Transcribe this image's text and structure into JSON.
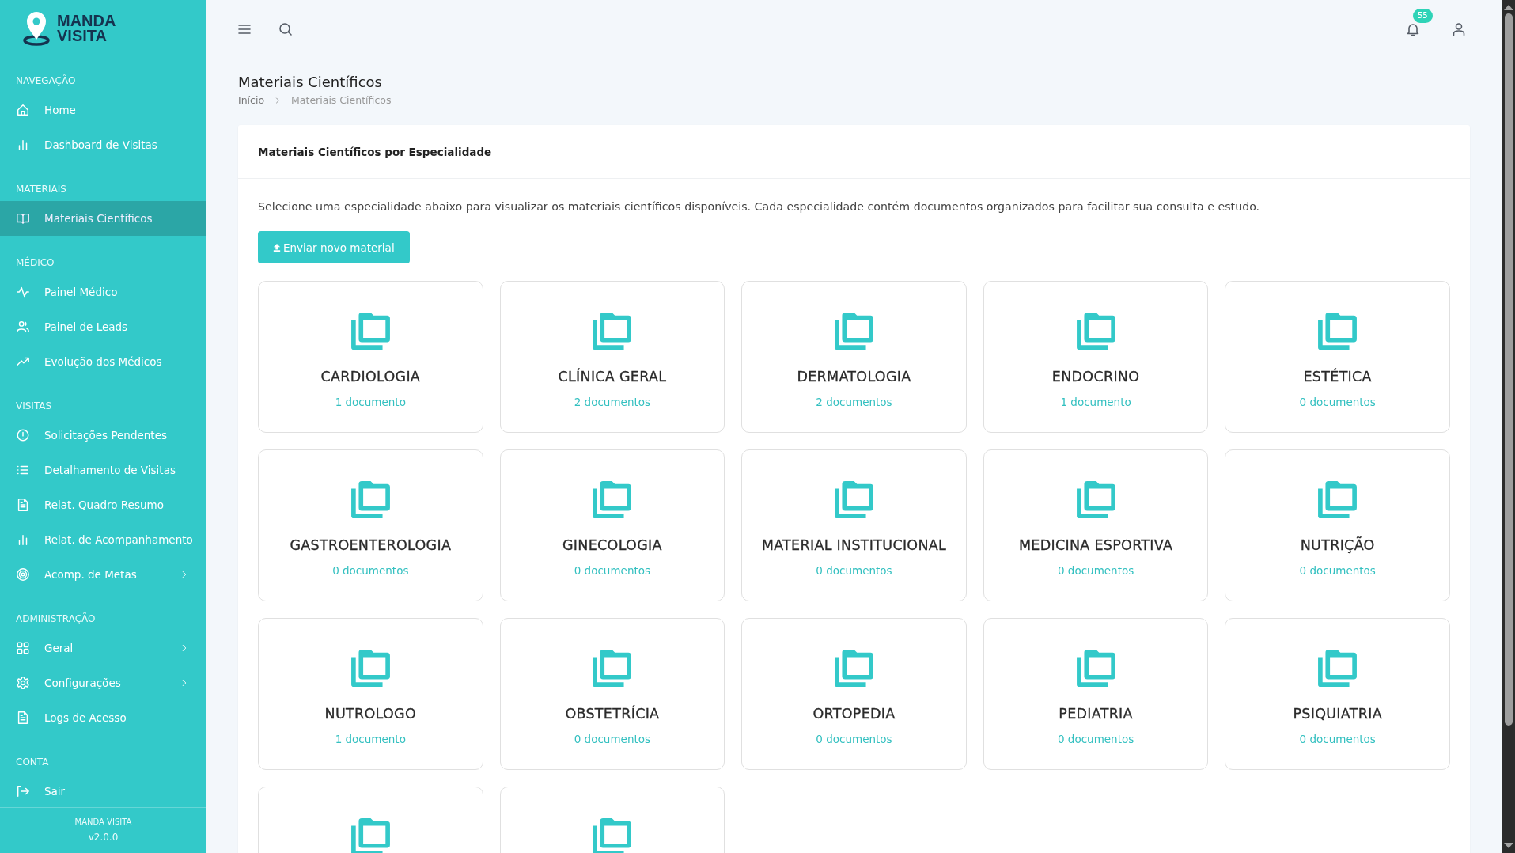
{
  "sidebar": {
    "logo": {
      "line1": "MANDA",
      "line2": "VISITA"
    },
    "sections": [
      {
        "title": "NAVEGAÇÃO",
        "items": [
          {
            "label": "Home",
            "selected": false,
            "expandable": false
          },
          {
            "label": "Dashboard de Visitas",
            "selected": false,
            "expandable": false
          }
        ]
      },
      {
        "title": "MATERIAIS",
        "items": [
          {
            "label": "Materiais Científicos",
            "selected": true,
            "expandable": false
          }
        ]
      },
      {
        "title": "MÉDICO",
        "items": [
          {
            "label": "Painel Médico",
            "selected": false,
            "expandable": false
          },
          {
            "label": "Painel de Leads",
            "selected": false,
            "expandable": false
          },
          {
            "label": "Evolução dos Médicos",
            "selected": false,
            "expandable": false
          }
        ]
      },
      {
        "title": "VISITAS",
        "items": [
          {
            "label": "Solicitações Pendentes",
            "selected": false,
            "expandable": false
          },
          {
            "label": "Detalhamento de Visitas",
            "selected": false,
            "expandable": false
          },
          {
            "label": "Relat. Quadro Resumo",
            "selected": false,
            "expandable": false
          },
          {
            "label": "Relat. de Acompanhamento",
            "selected": false,
            "expandable": false
          },
          {
            "label": "Acomp. de Metas",
            "selected": false,
            "expandable": true
          }
        ]
      },
      {
        "title": "ADMINISTRAÇÃO",
        "items": [
          {
            "label": "Geral",
            "selected": false,
            "expandable": true
          },
          {
            "label": "Configurações",
            "selected": false,
            "expandable": true
          },
          {
            "label": "Logs de Acesso",
            "selected": false,
            "expandable": false
          }
        ]
      },
      {
        "title": "CONTA",
        "items": [
          {
            "label": "Sair",
            "selected": false,
            "expandable": false
          }
        ]
      }
    ],
    "footer": {
      "name": "MANDA VISITA",
      "version": "v2.0.0"
    }
  },
  "topbar": {
    "notification_count": "55"
  },
  "page": {
    "title": "Materiais Científicos",
    "breadcrumb": [
      "Início",
      "Materiais Científicos"
    ]
  },
  "panel": {
    "title": "Materiais Científicos por Especialidade",
    "description": "Selecione uma especialidade abaixo para visualizar os materiais científicos disponíveis. Cada especialidade contém documentos organizados para facilitar sua consulta e estudo.",
    "upload_button": "Enviar novo material",
    "specialties": [
      {
        "kind": "card",
        "name": "CARDIOLOGIA",
        "documents": "1 documento"
      },
      {
        "kind": "card",
        "name": "CLÍNICA GERAL",
        "documents": "2 documentos"
      },
      {
        "kind": "card",
        "name": "DERMATOLOGIA",
        "documents": "2 documentos"
      },
      {
        "kind": "card",
        "name": "ENDOCRINO",
        "documents": "1 documento"
      },
      {
        "kind": "card",
        "name": "ESTÉTICA",
        "documents": "0 documentos"
      },
      {
        "kind": "card",
        "name": "GASTROENTEROLOGIA",
        "documents": "0 documentos"
      },
      {
        "kind": "card",
        "name": "GINECOLOGIA",
        "documents": "0 documentos"
      },
      {
        "kind": "card",
        "name": "MATERIAL INSTITUCIONAL",
        "documents": "0 documentos"
      },
      {
        "kind": "card",
        "name": "MEDICINA ESPORTIVA",
        "documents": "0 documentos"
      },
      {
        "kind": "card",
        "name": "NUTRIÇÃO",
        "documents": "0 documentos"
      },
      {
        "kind": "card",
        "name": "NUTROLOGO",
        "documents": "1 documento"
      },
      {
        "kind": "card",
        "name": "OBSTETRÍCIA",
        "documents": "0 documentos"
      },
      {
        "kind": "card",
        "name": "ORTOPEDIA",
        "documents": "0 documentos"
      },
      {
        "kind": "card",
        "name": "PEDIATRIA",
        "documents": "0 documentos"
      },
      {
        "kind": "card",
        "name": "PSIQUIATRIA",
        "documents": "0 documentos"
      },
      {
        "kind": "partial"
      },
      {
        "kind": "partial"
      }
    ]
  }
}
